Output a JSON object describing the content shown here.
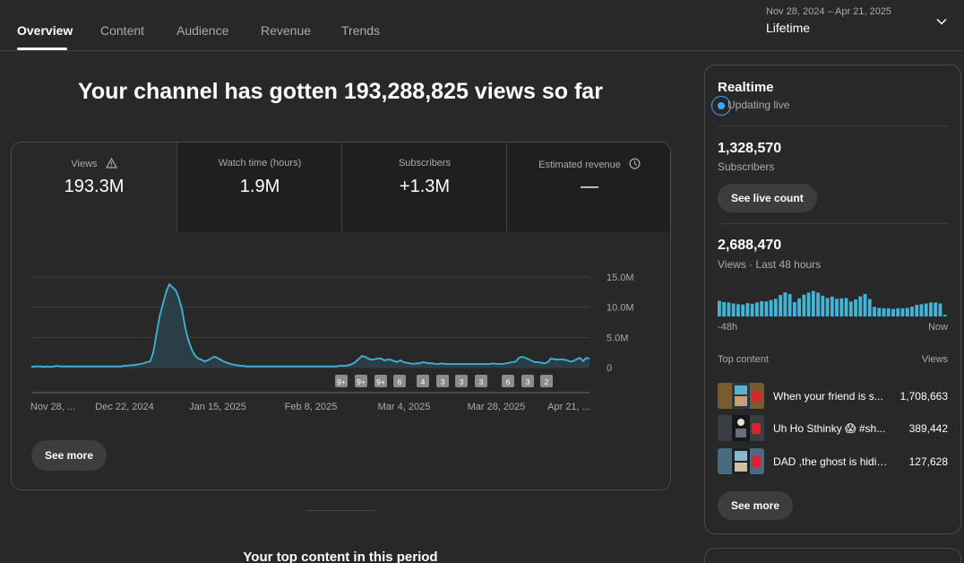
{
  "nav": {
    "tabs": [
      {
        "label": "Overview",
        "active": true
      },
      {
        "label": "Content",
        "active": false
      },
      {
        "label": "Audience",
        "active": false
      },
      {
        "label": "Revenue",
        "active": false
      },
      {
        "label": "Trends",
        "active": false
      }
    ],
    "date_range": "Nov 28, 2024 – Apr 21, 2025",
    "period": "Lifetime"
  },
  "headline": "Your channel has gotten 193,288,825 views so far",
  "metrics": [
    {
      "label": "Views",
      "value": "193.3M",
      "icon": "warning-icon",
      "selected": true
    },
    {
      "label": "Watch time (hours)",
      "value": "1.9M",
      "icon": "",
      "selected": false
    },
    {
      "label": "Subscribers",
      "value": "+1.3M",
      "icon": "",
      "selected": false
    },
    {
      "label": "Estimated revenue",
      "value": "—",
      "icon": "clock-icon",
      "selected": false
    }
  ],
  "chart_data": {
    "type": "area",
    "x_labels": [
      "Nov 28, ...",
      "Dec 22, 2024",
      "Jan 15, 2025",
      "Feb 8, 2025",
      "Mar 4, 2025",
      "Mar 28, 2025",
      "Apr 21, ..."
    ],
    "y_ticks": [
      "15.0M",
      "10.0M",
      "5.0M",
      "0"
    ],
    "ylim": [
      0,
      15
    ],
    "y_unit": "M",
    "grid": true,
    "series": [
      {
        "color": "#41b4d8",
        "values": [
          0.1,
          0.2,
          0.2,
          0.2,
          0.1,
          0.2,
          0.1,
          0.2,
          0.3,
          0.2,
          0.2,
          0.2,
          0.2,
          0.2,
          0.2,
          0.2,
          0.2,
          0.2,
          0.2,
          0.2,
          0.2,
          0.2,
          0.2,
          0.2,
          0.2,
          0.2,
          0.2,
          0.2,
          0.2,
          0.3,
          0.3,
          0.4,
          0.4,
          0.5,
          0.6,
          0.7,
          0.9,
          1.0,
          2.5,
          5.5,
          8.5,
          10.5,
          12.5,
          13.8,
          13.3,
          12.8,
          11.5,
          9.5,
          6.5,
          4.5,
          3.0,
          2.0,
          1.5,
          1.3,
          1.0,
          1.2,
          1.5,
          1.8,
          1.6,
          1.3,
          1.0,
          0.8,
          0.6,
          0.5,
          0.4,
          0.3,
          0.3,
          0.2,
          0.2,
          0.2,
          0.2,
          0.2,
          0.2,
          0.2,
          0.2,
          0.2,
          0.2,
          0.2,
          0.2,
          0.2,
          0.2,
          0.2,
          0.2,
          0.2,
          0.2,
          0.2,
          0.2,
          0.2,
          0.2,
          0.2,
          0.2,
          0.2,
          0.2,
          0.2,
          0.2,
          0.2,
          0.3,
          0.3,
          0.3,
          0.4,
          0.6,
          0.9,
          1.4,
          1.9,
          1.8,
          1.5,
          1.3,
          1.4,
          1.5,
          1.5,
          1.2,
          1.3,
          1.3,
          1.1,
          0.9,
          1.2,
          0.9,
          0.8,
          0.7,
          0.6,
          0.7,
          0.7,
          0.9,
          0.8,
          0.7,
          0.7,
          0.6,
          0.6,
          0.7,
          0.6,
          0.6,
          0.6,
          0.6,
          0.6,
          0.6,
          0.6,
          0.6,
          0.6,
          0.6,
          0.6,
          0.6,
          0.6,
          0.6,
          0.6,
          0.7,
          0.6,
          0.6,
          0.6,
          0.7,
          0.8,
          0.9,
          1.0,
          1.6,
          1.8,
          1.6,
          1.4,
          1.1,
          0.9,
          0.9,
          0.8,
          0.7,
          0.9,
          1.5,
          1.4,
          1.3,
          1.4,
          1.3,
          1.2,
          1.0,
          1.1,
          1.4,
          1.6,
          1.1,
          1.6,
          1.5
        ]
      }
    ],
    "markers": [
      "9+",
      "9+",
      "9+",
      "6",
      "4",
      "3",
      "3",
      "3",
      "6",
      "3",
      "2"
    ]
  },
  "see_more": "See more",
  "top_content_heading": "Your top content in this period",
  "realtime": {
    "title": "Realtime",
    "status": "Updating live",
    "subscribers_value": "1,328,570",
    "subscribers_label": "Subscribers",
    "live_count_button": "See live count",
    "views_value": "2,688,470",
    "views_label": "Views · Last 48 hours",
    "bars": [
      0.46,
      0.42,
      0.41,
      0.38,
      0.36,
      0.35,
      0.39,
      0.37,
      0.41,
      0.45,
      0.44,
      0.48,
      0.52,
      0.63,
      0.71,
      0.66,
      0.42,
      0.53,
      0.64,
      0.7,
      0.75,
      0.7,
      0.61,
      0.54,
      0.58,
      0.52,
      0.53,
      0.54,
      0.44,
      0.5,
      0.59,
      0.66,
      0.51,
      0.28,
      0.25,
      0.24,
      0.24,
      0.22,
      0.24,
      0.24,
      0.25,
      0.29,
      0.34,
      0.36,
      0.38,
      0.41,
      0.41,
      0.38,
      0.05
    ],
    "bar_color": "#41b4d8",
    "axis_start": "-48h",
    "axis_end": "Now",
    "top_content_label": "Top content",
    "views_col_label": "Views",
    "top_items": [
      {
        "title": "When your friend is s...",
        "views": "1,708,663"
      },
      {
        "title": "Uh Ho Sthinky 😱 #sh...",
        "views": "389,442"
      },
      {
        "title": "DAD ,the ghost is hidin...",
        "views": "127,628"
      }
    ],
    "see_more": "See more"
  }
}
